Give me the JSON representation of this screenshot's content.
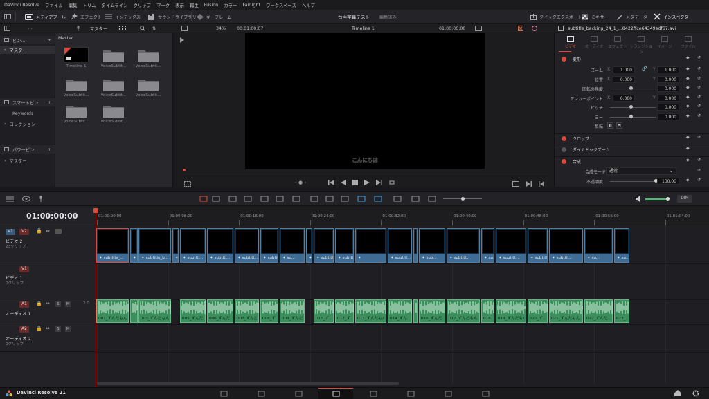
{
  "menu": [
    "DaVinci Resolve",
    "ファイル",
    "編集",
    "トリム",
    "タイムライン",
    "クリップ",
    "マーク",
    "表示",
    "再生",
    "Fusion",
    "カラー",
    "Fairlight",
    "ワークスペース",
    "ヘルプ"
  ],
  "toolbar": {
    "media_pool": "メディアプール",
    "effects": "エフェクト",
    "index": "インデックス",
    "sound_library": "サウンドライブラリ",
    "keyframe": "キーフレーム",
    "project_title": "音声字幕テスト",
    "project_status": "編集済み",
    "quick_export": "クイックエクスポート",
    "mixer": "ミキサー",
    "metadata": "メタデータ",
    "inspector": "インスペクタ"
  },
  "subbar": {
    "master": "マスター",
    "zoom": "34%",
    "viewer_tc": "00:01:00:07",
    "timeline_name": "Timeline 1",
    "timeline_tc": "01:00:00:00",
    "clip_name": "subtitle_backing_24_1_...8422ffce64349edf67.avi"
  },
  "bins": {
    "header": "ビン...",
    "master": "マスター",
    "smart_bins": "スマートビン",
    "keywords": "Keywords",
    "collections": "コレクション",
    "power_bins": "パワービン",
    "power_master": "マスター"
  },
  "media": {
    "header": "Master",
    "items": [
      "Timeline 1",
      "VoiceSubtit...",
      "VoiceSubtit...",
      "VoiceSubtit...",
      "VoiceSubtit...",
      "VoiceSubtit...",
      "VoiceSubtit...",
      "VoiceSubtit..."
    ]
  },
  "viewer": {
    "subtitle": "こんにちは"
  },
  "inspector": {
    "tabs": [
      "ビデオ",
      "オーディオ",
      "エフェクト",
      "トランジション",
      "イメージ",
      "ファイル"
    ],
    "transform": "変形",
    "zoom_label": "ズーム",
    "position_label": "位置",
    "rotation_label": "回転の角度",
    "anchor_label": "アンカーポイント",
    "pitch_label": "ピッチ",
    "yaw_label": "ヨー",
    "flip_label": "反転",
    "zoom_x": "1.000",
    "zoom_y": "1.000",
    "pos_x": "0.000",
    "pos_y": "0.000",
    "rot": "0.000",
    "anchor_x": "0.000",
    "anchor_y": "0.000",
    "pitch": "0.000",
    "yaw": "0.000",
    "x": "X",
    "y": "Y",
    "crop": "クロップ",
    "dynamic_zoom": "ダイナミックズーム",
    "composite": "合成",
    "composite_mode_label": "合成モード",
    "composite_mode": "通常",
    "opacity_label": "不透明度",
    "opacity": "100.00"
  },
  "timeline": {
    "timecode": "01:00:00:00",
    "dim": "DIM",
    "ruler": [
      "01:00:00:00",
      "01:00:08:00",
      "01:00:16:00",
      "01:00:24:00",
      "01:00:32:00",
      "01:00:40:00",
      "01:00:48:00",
      "01:00:56:00",
      "01:01:04:00"
    ],
    "tracks": {
      "v2_tag": "V2",
      "v1_tag": "V1",
      "v2_name": "ビデオ 2",
      "v2_clips": "23クリップ",
      "v1_tag2": "V1",
      "v1_name": "ビデオ 1",
      "v1_clips": "0クリップ",
      "a1_tag": "A1",
      "a1_name": "オーディオ 1",
      "a1_level": "2.0",
      "a2_tag": "A2",
      "a2_name": "オーディオ 2",
      "a2_clips": "0クリップ"
    },
    "video_clips": [
      "subtitle_...",
      "",
      "subtitle_b...",
      "subtit...",
      "subtitl...",
      "subtitl...",
      "subtitl...",
      "subtitl...",
      "su...",
      "su...",
      "subtitl...",
      "subtitl...",
      "",
      "subtitl...",
      "subtitle_b...",
      "sub...",
      "subtitl...",
      "su...",
      "subtitl...",
      "subtitle_b...",
      "subtitl...",
      "su...",
      "su..."
    ],
    "audio_clips": [
      "001_ずんだもん...",
      "",
      "003_ずんだもん...",
      "005_ずんだ...",
      "006_ずんだ...",
      "007_ずんだ...",
      "008_ず...",
      "009_ずんだ...",
      "011_ず...",
      "012_ず...",
      "013_ずんだもん...",
      "014_ずん...",
      "",
      "016_ずんだ...",
      "017_ずんだもん...",
      "018...",
      "019_ずんだもん...",
      "020_ず...",
      "021_ずんだもん...",
      "022_ずんだ...",
      "023_..."
    ]
  },
  "bottom": {
    "app_name": "DaVinci Resolve 21"
  },
  "colors": {
    "accent_red": "#e0483c",
    "video_clip": "#3e6c94",
    "audio_clip": "#3a8f5c"
  }
}
